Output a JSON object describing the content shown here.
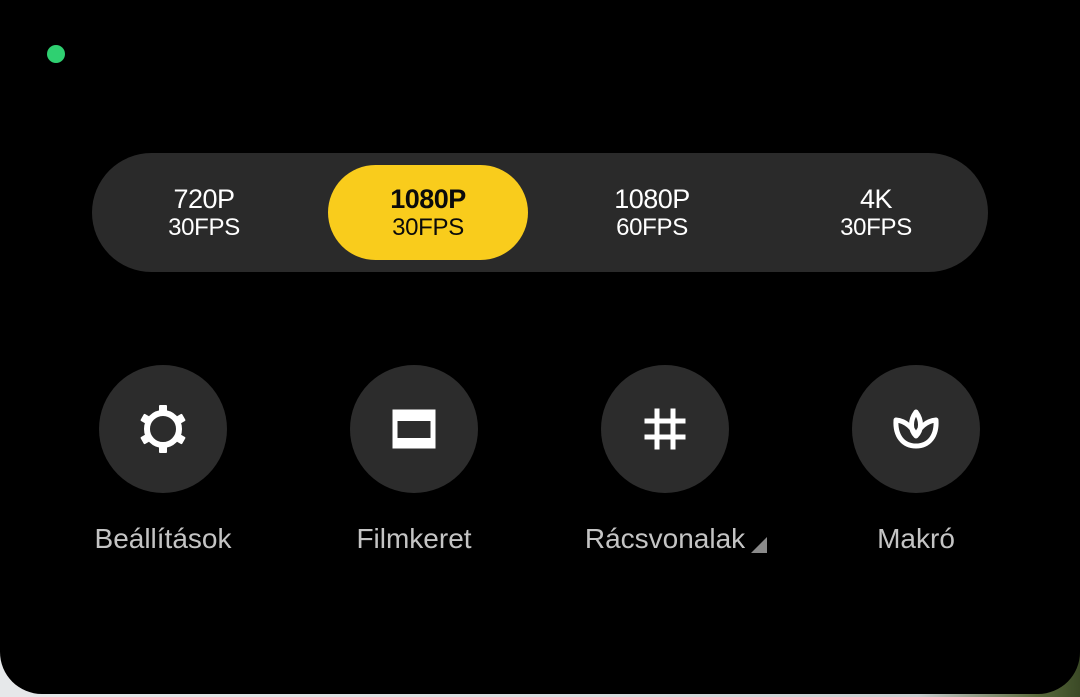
{
  "resolution_options": [
    {
      "resolution": "720P",
      "fps": "30FPS",
      "selected": false
    },
    {
      "resolution": "1080P",
      "fps": "30FPS",
      "selected": true
    },
    {
      "resolution": "1080P",
      "fps": "60FPS",
      "selected": false
    },
    {
      "resolution": "4K",
      "fps": "30FPS",
      "selected": false
    }
  ],
  "controls": [
    {
      "label": "Beállítások",
      "icon": "gear-icon"
    },
    {
      "label": "Filmkeret",
      "icon": "frame-icon"
    },
    {
      "label": "Rácsvonalak",
      "icon": "grid-icon",
      "has_submenu": true
    },
    {
      "label": "Makró",
      "icon": "macro-flower-icon"
    }
  ],
  "colors": {
    "selected_accent": "#f9cc1c",
    "status_dot": "#2fd071",
    "panel_background": "#000000",
    "control_background": "#2c2c2c"
  }
}
